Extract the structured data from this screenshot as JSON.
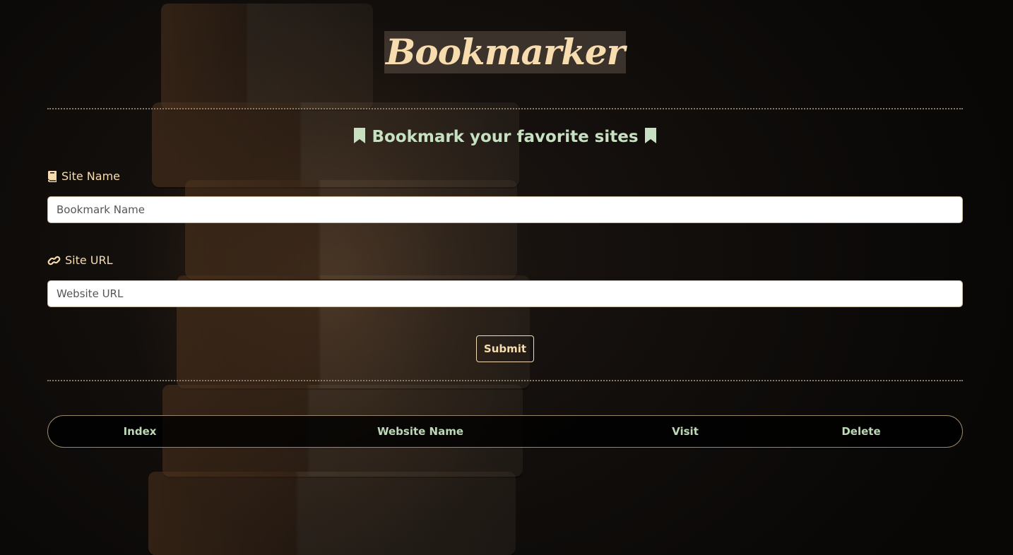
{
  "app": {
    "title": "Bookmarker"
  },
  "form": {
    "subtitle": "Bookmark your favorite sites",
    "subtitle_icon": "bookmark-icon",
    "site_name": {
      "label": "Site Name",
      "icon": "book-icon",
      "placeholder": "Bookmark Name",
      "value": ""
    },
    "site_url": {
      "label": "Site URL",
      "icon": "link-icon",
      "placeholder": "Website URL",
      "value": ""
    },
    "submit_label": "Submit"
  },
  "table": {
    "headers": [
      "Index",
      "Website Name",
      "Visit",
      "Delete"
    ],
    "rows": []
  },
  "colors": {
    "title": "#f6dcae",
    "accent_green": "#c7e0c2",
    "label": "#f6dcae",
    "divider": "#8c7a62"
  }
}
